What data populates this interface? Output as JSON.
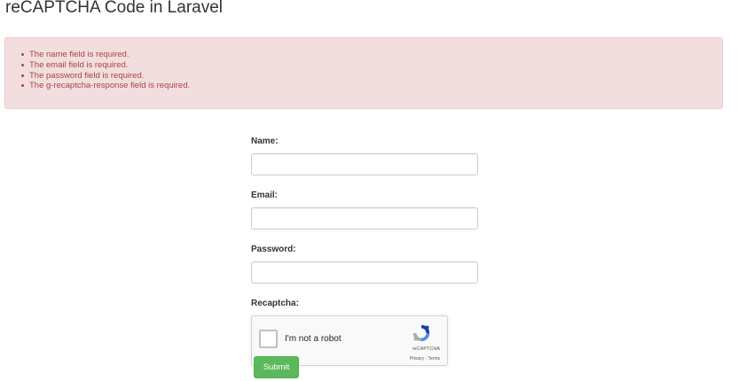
{
  "page": {
    "title": "reCAPTCHA Code in Laravel"
  },
  "errors": {
    "items": [
      "The name field is required.",
      "The email field is required.",
      "The password field is required.",
      "The g-recaptcha-response field is required."
    ],
    "color": "#a94442",
    "background": "#f2dede"
  },
  "form": {
    "name_label": "Name:",
    "name_value": "",
    "email_label": "Email:",
    "email_value": "",
    "password_label": "Password:",
    "password_value": "",
    "recaptcha_label": "Recaptcha:",
    "submit_label": "Submit",
    "submit_color": "#5cb85c"
  },
  "recaptcha": {
    "checkbox_text": "I'm not a robot",
    "checked": false,
    "brand": "reCAPTCHA",
    "privacy_link": "Privacy",
    "separator": " - ",
    "terms_link": "Terms",
    "icon": "recaptcha-logo-icon"
  }
}
